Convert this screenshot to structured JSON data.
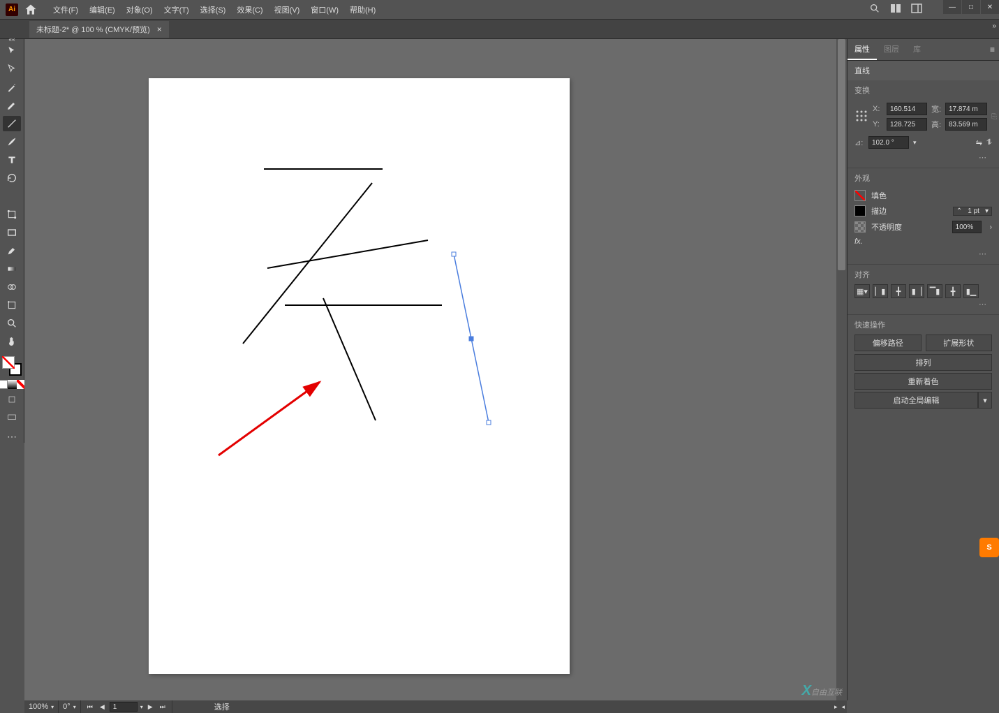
{
  "menu": {
    "file": "文件(F)",
    "edit": "编辑(E)",
    "object": "对象(O)",
    "text": "文字(T)",
    "select": "选择(S)",
    "effect": "效果(C)",
    "view": "视图(V)",
    "window": "窗口(W)",
    "help": "帮助(H)"
  },
  "tab": {
    "title": "未标题-2* @ 100 % (CMYK/预览)",
    "close": "×"
  },
  "panel": {
    "tabs": {
      "properties": "属性",
      "layers": "图层",
      "libraries": "库"
    },
    "line_label": "直线",
    "transform_title": "变换",
    "x_label": "X:",
    "x_value": "160.514",
    "y_label": "Y:",
    "y_value": "128.725",
    "w_label": "宽:",
    "w_value": "17.874 m",
    "h_label": "高:",
    "h_value": "83.569 m",
    "angle_label": "⊿:",
    "angle_value": "102.0 °",
    "appearance_title": "外观",
    "fill_label": "填色",
    "stroke_label": "描边",
    "stroke_weight": "1 pt",
    "opacity_label": "不透明度",
    "opacity_value": "100%",
    "fx_label": "fx.",
    "align_title": "对齐",
    "quick_title": "快速操作",
    "offset_path": "偏移路径",
    "expand_shape": "扩展形状",
    "arrange": "排列",
    "recolor": "重新着色",
    "global_edit": "启动全局编辑"
  },
  "status": {
    "zoom": "100%",
    "rotate": "0°",
    "page": "1",
    "select": "选择"
  },
  "watermark": "自由互联"
}
